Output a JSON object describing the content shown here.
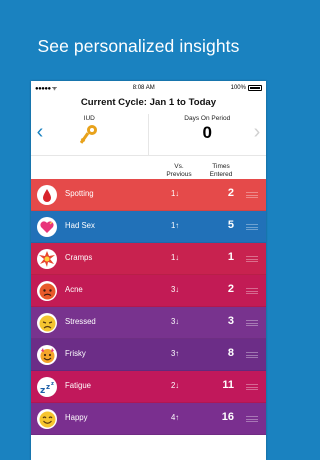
{
  "headline": "See personalized insights",
  "status_bar": {
    "signal": "●●●●● ᯤ",
    "time": "8:08 AM",
    "battery": "100%"
  },
  "cycle_title": "Current Cycle: Jan  1 to Today",
  "summary": {
    "method_label": "IUD",
    "days_label": "Days On Period",
    "days_value": "0"
  },
  "column_headers": {
    "vs_previous": "Vs. Previous",
    "times_entered": "Times Entered"
  },
  "symptoms": [
    {
      "label": "Spotting",
      "change": "1↓",
      "count": "2",
      "color": "#e54a4a",
      "icon": "blood-drop-icon"
    },
    {
      "label": "Had Sex",
      "change": "1↑",
      "count": "5",
      "color": "#2171b8",
      "icon": "heart-icon"
    },
    {
      "label": "Cramps",
      "change": "1↓",
      "count": "1",
      "color": "#c8224f",
      "icon": "burst-icon"
    },
    {
      "label": "Acne",
      "change": "3↓",
      "count": "2",
      "color": "#c21b55",
      "icon": "angry-face-icon"
    },
    {
      "label": "Stressed",
      "change": "3↓",
      "count": "3",
      "color": "#78338e",
      "icon": "stressed-face-icon"
    },
    {
      "label": "Frisky",
      "change": "3↑",
      "count": "8",
      "color": "#6c2d87",
      "icon": "devil-face-icon"
    },
    {
      "label": "Fatigue",
      "change": "2↓",
      "count": "11",
      "color": "#c1185b",
      "icon": "sleepy-zzz-icon"
    },
    {
      "label": "Happy",
      "change": "4↑",
      "count": "16",
      "color": "#7a2f8f",
      "icon": "happy-face-icon"
    }
  ]
}
